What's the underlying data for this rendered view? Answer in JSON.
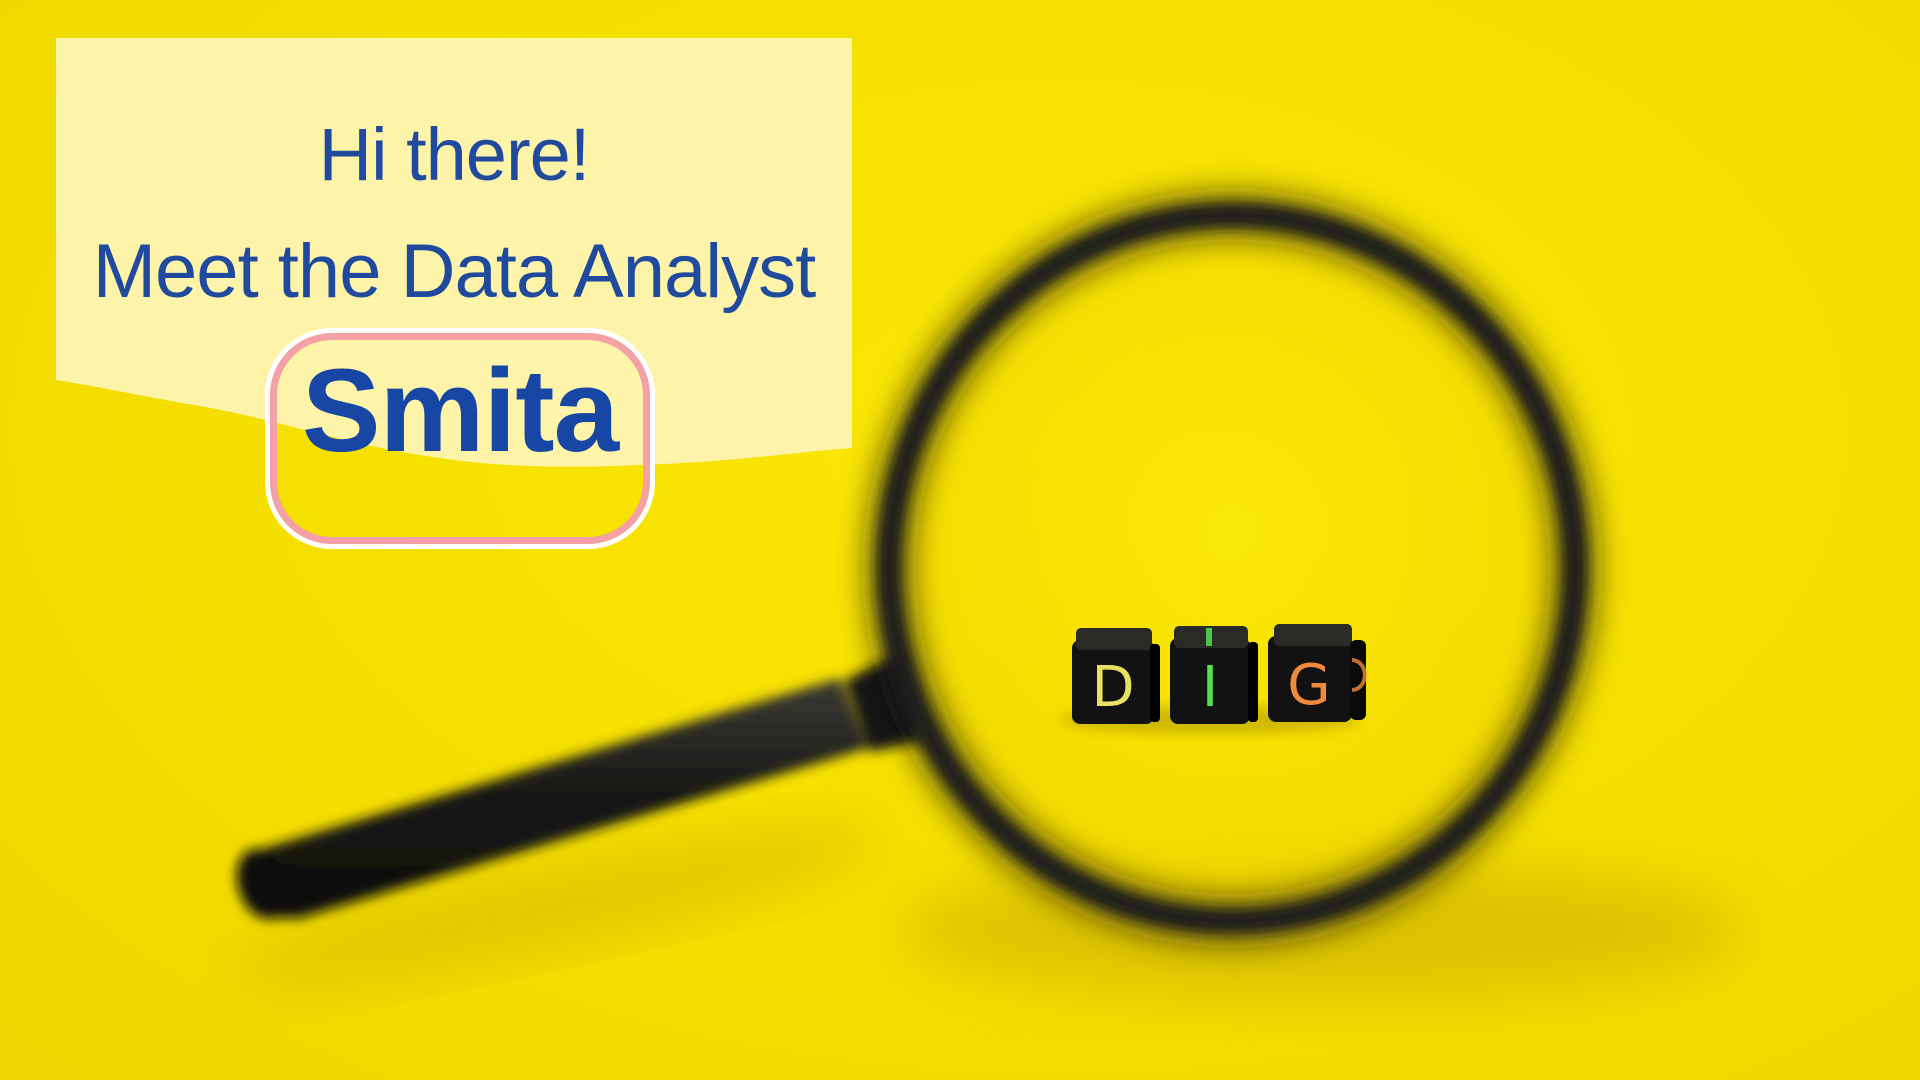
{
  "greeting": "Hi there!",
  "subtitle": "Meet the Data Analyst",
  "name": "Smita",
  "cubes": [
    "D",
    "I",
    "G"
  ],
  "colors": {
    "background": "#f5df00",
    "banner": "#fdf5b6",
    "text": "#1f4a9e",
    "name_text": "#1746a5",
    "name_frame": "#f3a0a6",
    "magnifier": "#141414",
    "cube_d": "#e8e060",
    "cube_i": "#55e050",
    "cube_g": "#f08a3c"
  }
}
